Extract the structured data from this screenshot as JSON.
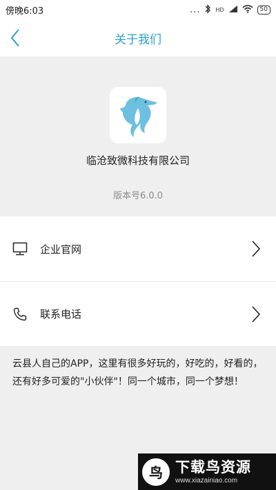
{
  "status_bar": {
    "time": "傍晚6:03",
    "signal_dots": "...",
    "hd_label": "HD",
    "battery": "50"
  },
  "nav": {
    "title": "关于我们"
  },
  "about": {
    "company_name": "临沧致微科技有限公司",
    "version": "版本号6.0.0"
  },
  "menu": {
    "items": [
      {
        "label": "企业官网",
        "icon": "monitor-icon"
      },
      {
        "label": "联系电话",
        "icon": "phone-icon"
      }
    ]
  },
  "intro": {
    "text": "云县人自己的APP，这里有很多好玩的，好吃的，好看的，还有好多可爱的\"小伙伴\"！同一个城市，同一个梦想！"
  },
  "watermark": {
    "title": "下载鸟资源",
    "url": "www.xiazainiao.com"
  },
  "colors": {
    "accent": "#27a1cf",
    "background": "#efefef"
  }
}
